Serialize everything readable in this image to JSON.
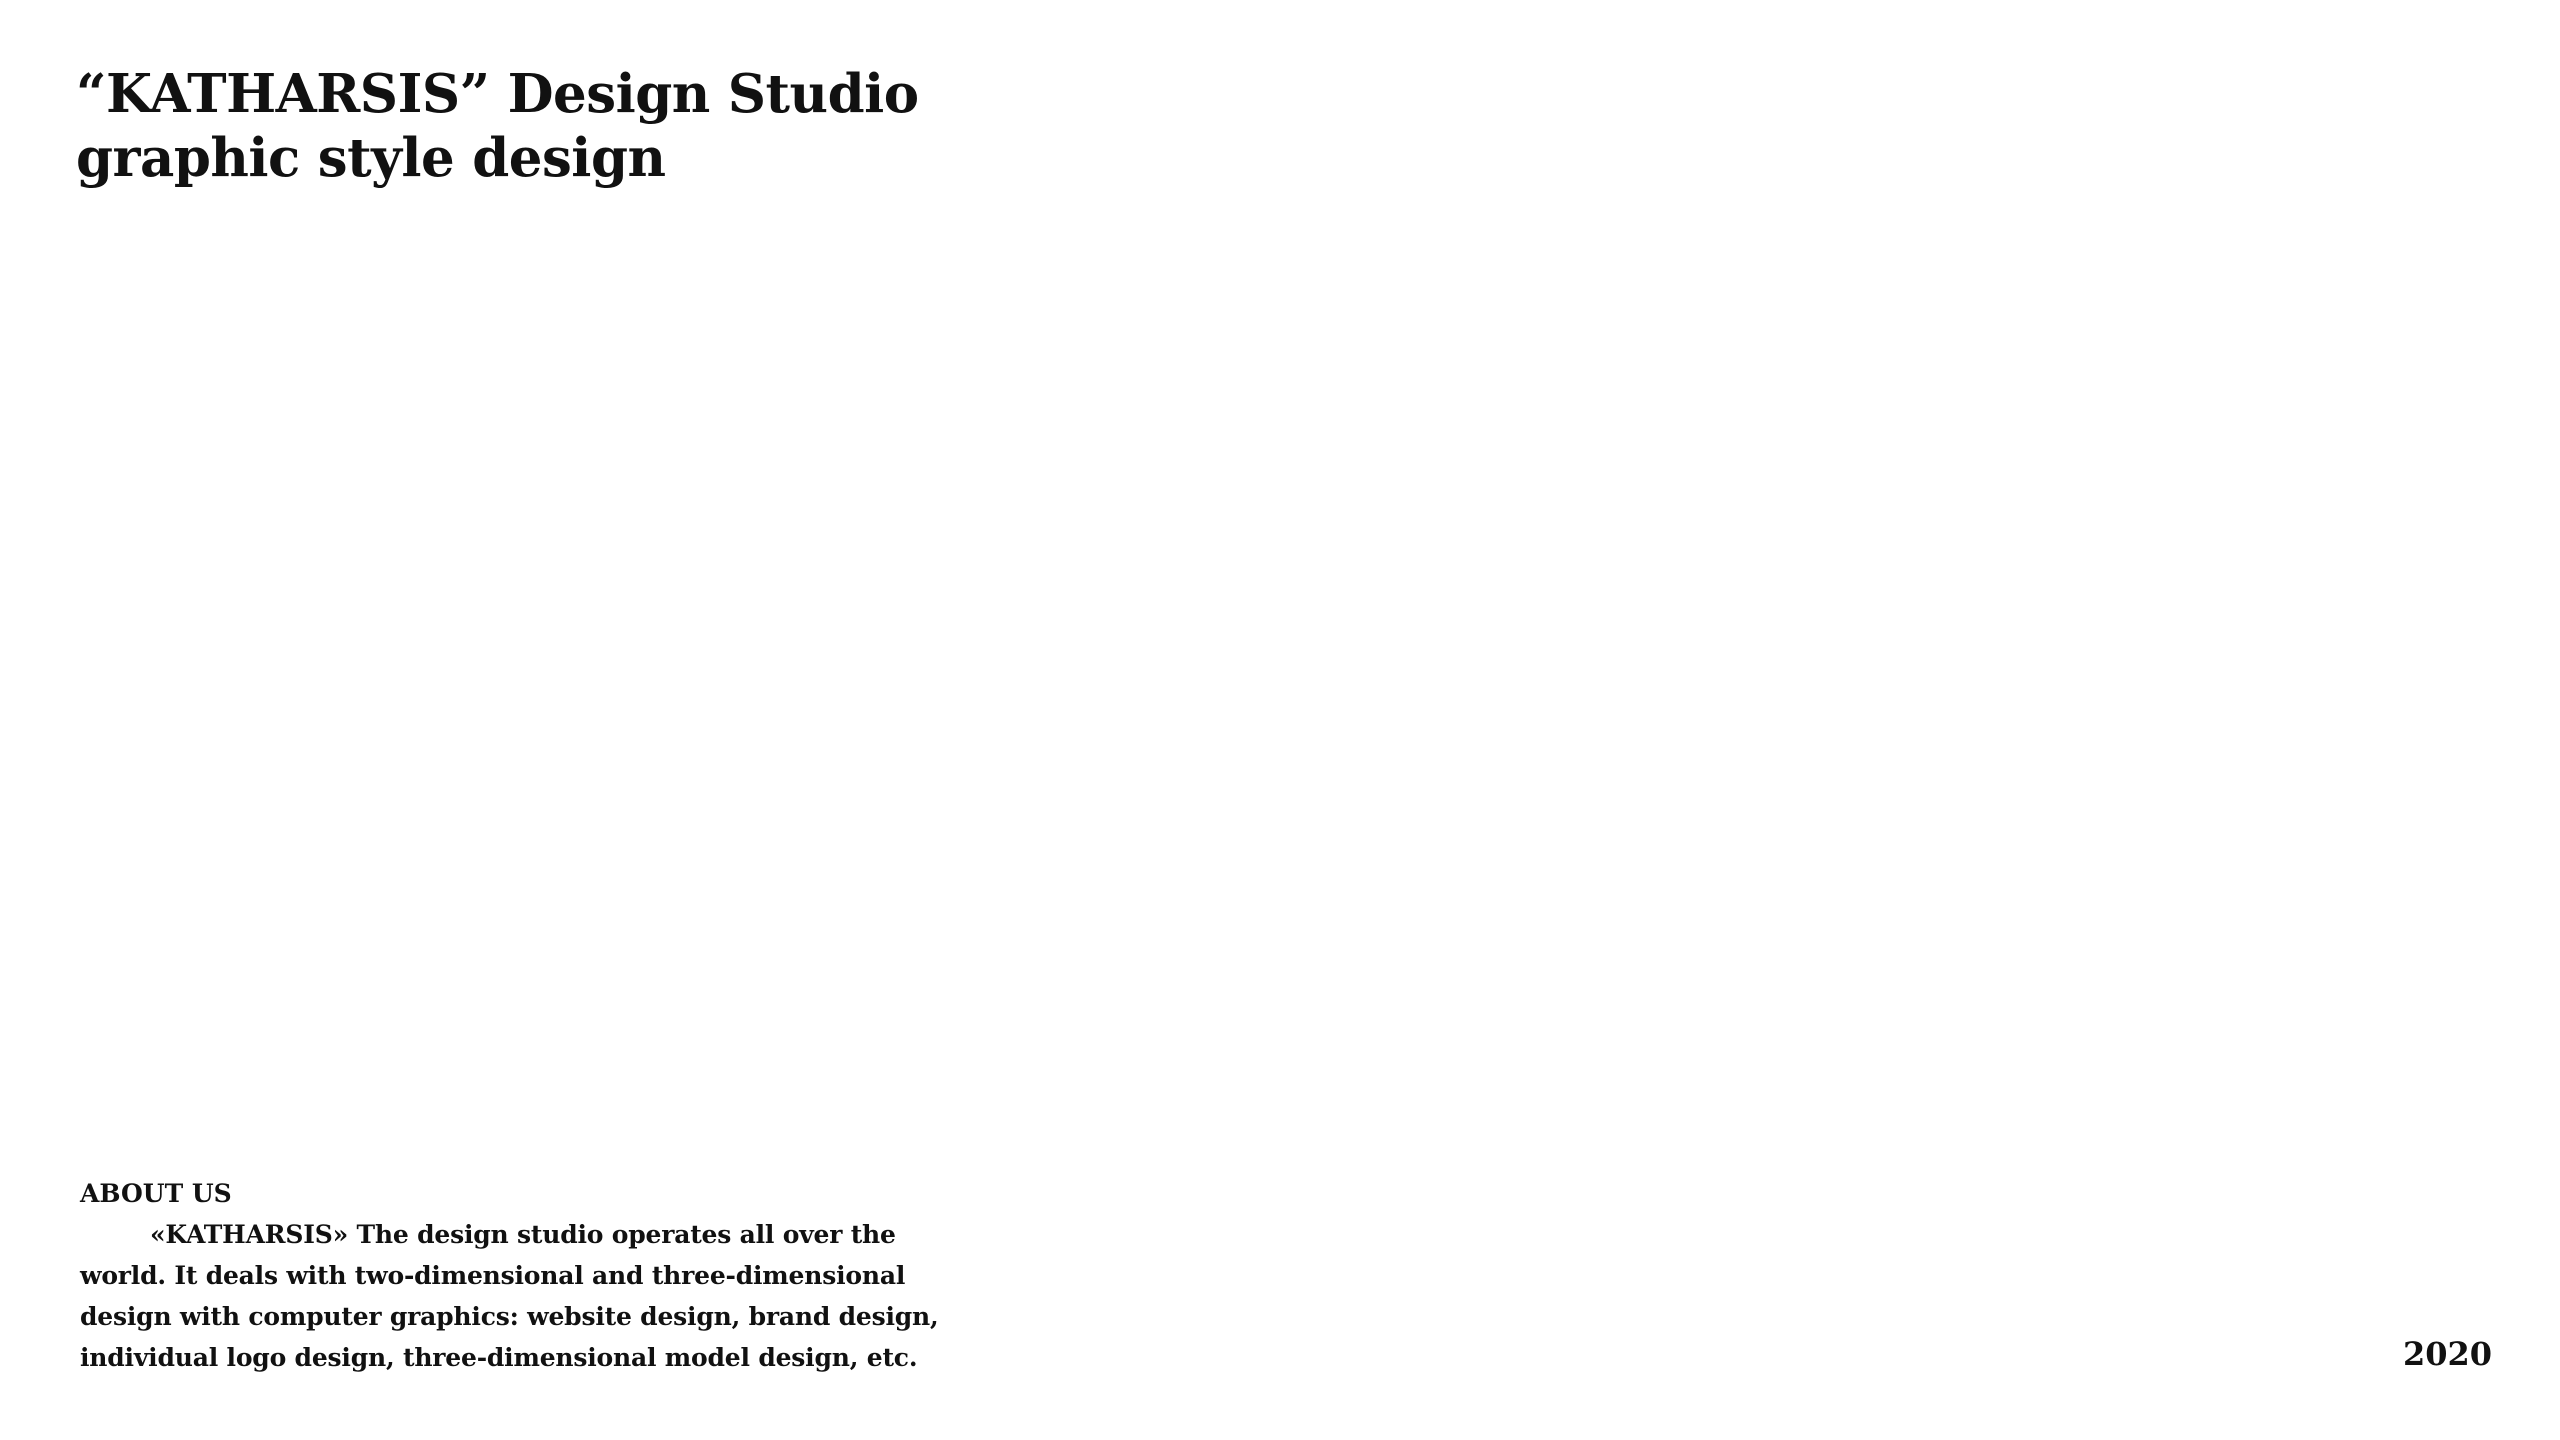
{
  "header": {
    "title_line1": "“KATHARSIS” Design Studio",
    "title_line2": "graphic style design"
  },
  "about": {
    "heading": "ABOUT US",
    "body": "«KATHARSIS» The design studio operates all over the world. It deals with two-dimensional and three-dimensional design with computer graphics: website design, brand design, individual logo design, three-dimensional model design, etc."
  },
  "footer": {
    "year": "2020"
  }
}
